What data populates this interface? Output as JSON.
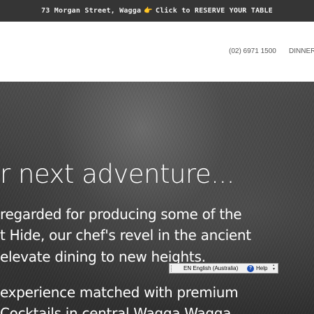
{
  "announcement": {
    "address": "73 Morgan Street, Wagga",
    "hand_emoji": "👉",
    "cta": "Click to RESERVE YOUR TABLE"
  },
  "nav": {
    "phone": "(02) 6971 1500",
    "dinner": "DINNER M"
  },
  "hero": {
    "heading": "r next adventure...",
    "lines": [
      "regarded for producing some of the",
      "t Hide, our chef's revel in the ancient",
      "elevate dining to new heights.",
      " experience matched with premium",
      "Cocktails in central Wagga Wagga."
    ]
  },
  "language_bar": {
    "language": "EN English (Australia)",
    "help_icon_glyph": "?",
    "help_label": "Help",
    "icon_names": [
      "grip-icon",
      "help-icon",
      "options-icon"
    ]
  },
  "colors": {
    "announcement_bg": "#353535",
    "header_bg": "#ffffff",
    "hero_text": "#ffffff"
  }
}
